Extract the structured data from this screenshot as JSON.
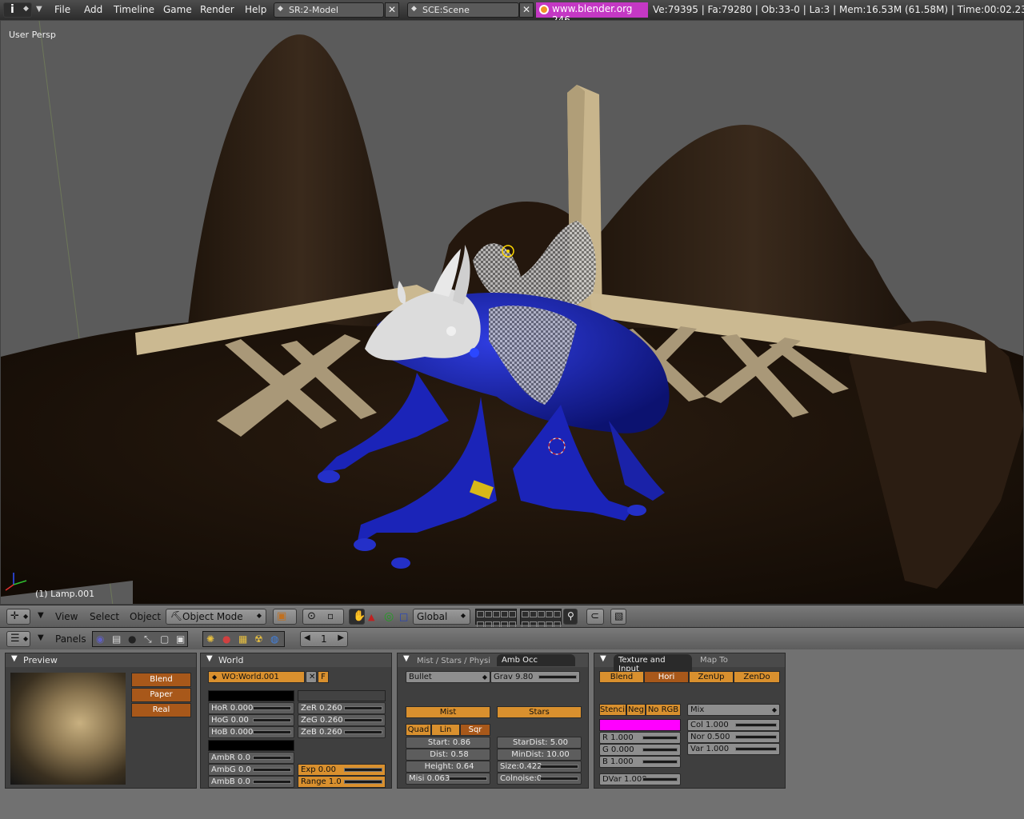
{
  "top_header": {
    "menus": [
      "File",
      "Add",
      "Timeline",
      "Game",
      "Render",
      "Help"
    ],
    "screen_field": "SR:2-Model",
    "scene_field": "SCE:Scene",
    "url": "www.blender.org 246",
    "stats": "Ve:79395 | Fa:79280 | Ob:33-0 | La:3  | Mem:16.53M (61.58M)  | Time:00:02.23 |"
  },
  "viewport": {
    "view_name": "User Persp",
    "active_object": "(1) Lamp.001"
  },
  "view3d_header": {
    "menus": [
      "View",
      "Select",
      "Object"
    ],
    "mode": "Object Mode",
    "orientation": "Global"
  },
  "buttons_header": {
    "panels_label": "Panels",
    "frame": "1"
  },
  "preview_panel": {
    "title": "Preview",
    "buttons": [
      "Blend",
      "Paper",
      "Real"
    ]
  },
  "world_panel": {
    "title": "World",
    "world_name": "WO:World.001",
    "fake_user": "F",
    "horizon": [
      "HoR 0.000",
      "HoG 0.00",
      "HoB 0.000"
    ],
    "zenith": [
      "ZeR 0.260",
      "ZeG 0.260",
      "ZeB 0.260"
    ],
    "ambient": [
      "AmbR 0.0",
      "AmbG 0.0",
      "AmbB 0.0"
    ],
    "exp": "Exp 0.00",
    "range": "Range 1.0"
  },
  "mist_panel": {
    "tabs": [
      "Mist / Stars / Physi",
      "Amb Occ"
    ],
    "physics_engine": "Bullet",
    "grav": "Grav 9.80",
    "mist_btn": "Mist",
    "stars_btn": "Stars",
    "falloff": [
      "Quad",
      "Lin",
      "Sqr"
    ],
    "start": "Start: 0.86",
    "dist": "Dist: 0.58",
    "height": "Height: 0.64",
    "misi": "Misi 0.063",
    "stardist": "StarDist: 5.00",
    "mindist": "MinDist: 10.00",
    "size": "Size:0.422",
    "colnoise": "Colnoise:0"
  },
  "texture_panel": {
    "tabs": [
      "Texture and Input",
      "Map To"
    ],
    "mapping": [
      "Blend",
      "Hori",
      "ZenUp",
      "ZenDo"
    ],
    "flags": [
      "Stencil",
      "Neg",
      "No RGB"
    ],
    "blend_mode": "Mix",
    "r": "R 1.000",
    "g": "G 0.000",
    "b": "B 1.000",
    "col": "Col  1.000",
    "nor": "Nor  0.500",
    "var": "Var  1.000",
    "dvar": "DVar 1.000"
  },
  "colors": {
    "accent_orange": "#d9902e",
    "selected_orange": "#a8581a",
    "url_magenta": "#c438c4",
    "texture_color": "#ff00ff"
  }
}
